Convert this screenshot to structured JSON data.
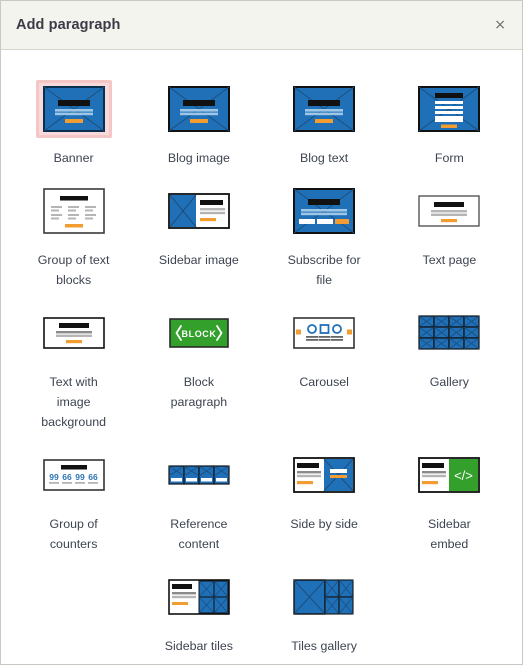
{
  "dialog": {
    "title": "Add paragraph",
    "close_label": "×",
    "close_icon": "close-icon"
  },
  "colors": {
    "blue": "#2070b8",
    "blue_dark": "#13406b",
    "orange": "#f39c32",
    "green": "#33a02c",
    "black": "#111111",
    "line_gray": "#b5b5b5",
    "selection_border": "#f4c6c6",
    "selection_bg": "#f9dada",
    "header_bg": "#f3f4ee",
    "label_text": "#3d4451",
    "counter_blue": "#2e74b5"
  },
  "paragraph_types": [
    {
      "label": "Banner",
      "icon": "banner-icon",
      "selected": true
    },
    {
      "label": "Blog image",
      "icon": "blog-image-icon",
      "selected": false
    },
    {
      "label": "Blog text",
      "icon": "blog-text-icon",
      "selected": false
    },
    {
      "label": "Form",
      "icon": "form-icon",
      "selected": false
    },
    {
      "label": "Group of text blocks",
      "icon": "group-of-text-blocks-icon",
      "selected": false
    },
    {
      "label": "Sidebar image",
      "icon": "sidebar-image-icon",
      "selected": false
    },
    {
      "label": "Subscribe for file",
      "icon": "subscribe-for-file-icon",
      "selected": false
    },
    {
      "label": "Text page",
      "icon": "text-page-icon",
      "selected": false
    },
    {
      "label": "Text with image background",
      "icon": "text-with-image-background-icon",
      "selected": false
    },
    {
      "label": "Block paragraph",
      "icon": "block-paragraph-icon",
      "icon_text": "BLOCK",
      "selected": false
    },
    {
      "label": "Carousel",
      "icon": "carousel-icon",
      "selected": false
    },
    {
      "label": "Gallery",
      "icon": "gallery-icon",
      "selected": false
    },
    {
      "label": "Group of counters",
      "icon": "group-of-counters-icon",
      "counters": [
        "99",
        "66",
        "99",
        "66"
      ],
      "selected": false
    },
    {
      "label": "Reference content",
      "icon": "reference-content-icon",
      "selected": false
    },
    {
      "label": "Side by side",
      "icon": "side-by-side-icon",
      "selected": false
    },
    {
      "label": "Sidebar embed",
      "icon": "sidebar-embed-icon",
      "icon_text": "</>",
      "selected": false
    },
    {
      "label": "Sidebar tiles",
      "icon": "sidebar-tiles-icon",
      "selected": false
    },
    {
      "label": "Tiles gallery",
      "icon": "tiles-gallery-icon",
      "selected": false
    }
  ]
}
